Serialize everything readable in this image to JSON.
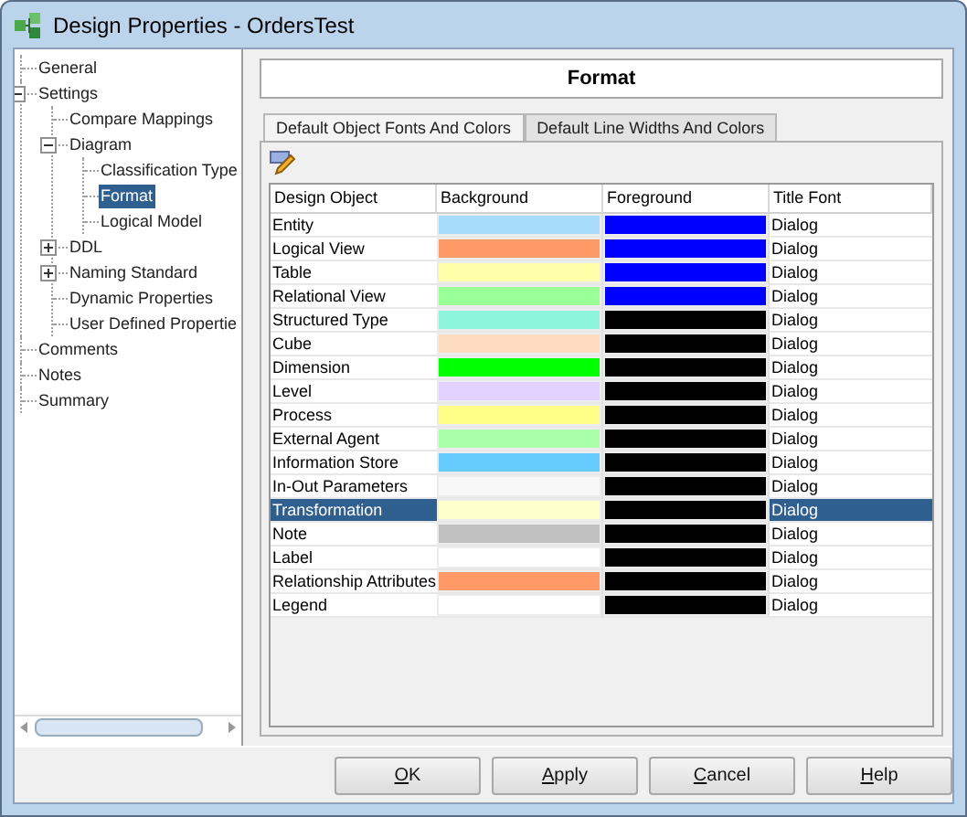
{
  "window": {
    "title": "Design Properties - OrdersTest"
  },
  "tree": [
    {
      "label": "General",
      "selected": false
    },
    {
      "label": "Settings",
      "selected": false,
      "expanded": true,
      "children": [
        {
          "label": "Compare Mappings",
          "selected": false
        },
        {
          "label": "Diagram",
          "selected": false,
          "expanded": true,
          "children": [
            {
              "label": "Classification Type",
              "selected": false
            },
            {
              "label": "Format",
              "selected": true
            },
            {
              "label": "Logical Model",
              "selected": false
            }
          ]
        },
        {
          "label": "DDL",
          "selected": false,
          "expanded": false
        },
        {
          "label": "Naming Standard",
          "selected": false,
          "expanded": false
        },
        {
          "label": "Dynamic Properties",
          "selected": false
        },
        {
          "label": "User Defined Propertie",
          "selected": false
        }
      ]
    },
    {
      "label": "Comments",
      "selected": false
    },
    {
      "label": "Notes",
      "selected": false
    },
    {
      "label": "Summary",
      "selected": false
    }
  ],
  "page_title": "Format",
  "tabs": [
    {
      "label": "Default Object Fonts And Colors",
      "selected": true
    },
    {
      "label": "Default Line Widths And Colors",
      "selected": false
    }
  ],
  "table": {
    "columns": [
      "Design Object",
      "Background",
      "Foreground",
      "Title Font"
    ],
    "rows": [
      {
        "name": "Entity",
        "background": {
          "color": "#a6dcfa"
        },
        "foreground": {
          "color": "#0000ff"
        },
        "title_font": "Dialog",
        "selected": false
      },
      {
        "name": "Logical View",
        "background": {
          "color": "#ff9966"
        },
        "foreground": {
          "color": "#0000ff"
        },
        "title_font": "Dialog",
        "selected": false
      },
      {
        "name": "Table",
        "background": {
          "color": "#ffffaa"
        },
        "foreground": {
          "color": "#0000ff"
        },
        "title_font": "Dialog",
        "selected": false
      },
      {
        "name": "Relational View",
        "background": {
          "color": "#99ff99"
        },
        "foreground": {
          "color": "#0000ff"
        },
        "title_font": "Dialog",
        "selected": false
      },
      {
        "name": "Structured Type",
        "background": {
          "color": "#8cf5dc"
        },
        "foreground": {
          "color": "#000000"
        },
        "title_font": "Dialog",
        "selected": false
      },
      {
        "name": "Cube",
        "background": {
          "color": "#fddcc0"
        },
        "foreground": {
          "color": "#000000"
        },
        "title_font": "Dialog",
        "selected": false
      },
      {
        "name": "Dimension",
        "background": {
          "color": "#00ff00"
        },
        "foreground": {
          "color": "#000000"
        },
        "title_font": "Dialog",
        "selected": false
      },
      {
        "name": "Level",
        "background": {
          "color": "#e2d0ff"
        },
        "foreground": {
          "color": "#000000"
        },
        "title_font": "Dialog",
        "selected": false
      },
      {
        "name": "Process",
        "background": {
          "color": "#ffff88"
        },
        "foreground": {
          "color": "#000000"
        },
        "title_font": "Dialog",
        "selected": false
      },
      {
        "name": "External Agent",
        "background": {
          "color": "#aaffaa"
        },
        "foreground": {
          "color": "#000000"
        },
        "title_font": "Dialog",
        "selected": false
      },
      {
        "name": "Information Store",
        "background": {
          "color": "#66ccff"
        },
        "foreground": {
          "color": "#000000"
        },
        "title_font": "Dialog",
        "selected": false
      },
      {
        "name": "In-Out Parameters",
        "background": {
          "color": "#f8f8f8"
        },
        "foreground": {
          "color": "#000000"
        },
        "title_font": "Dialog",
        "selected": false
      },
      {
        "name": "Transformation",
        "background": {
          "color": "#ffffcc"
        },
        "foreground": {
          "color": "#000000"
        },
        "title_font": "Dialog",
        "selected": true
      },
      {
        "name": "Note",
        "background": {
          "color": "#c0c0c0"
        },
        "foreground": {
          "color": "#000000"
        },
        "title_font": "Dialog",
        "selected": false
      },
      {
        "name": "Label",
        "background": {
          "color": "#ffffff"
        },
        "foreground": {
          "color": "#000000"
        },
        "title_font": "Dialog",
        "selected": false
      },
      {
        "name": "Relationship Attributes",
        "background": {
          "color": "#ff9966"
        },
        "foreground": {
          "color": "#000000"
        },
        "title_font": "Dialog",
        "selected": false
      },
      {
        "name": "Legend",
        "background": {
          "color": "#ffffff"
        },
        "foreground": {
          "color": "#000000"
        },
        "title_font": "Dialog",
        "selected": false
      }
    ]
  },
  "buttons": [
    {
      "label": "OK",
      "underline_first": true
    },
    {
      "label": "Apply",
      "underline_first": true
    },
    {
      "label": "Cancel",
      "underline_first": true
    },
    {
      "label": "Help",
      "underline_first": true
    }
  ]
}
